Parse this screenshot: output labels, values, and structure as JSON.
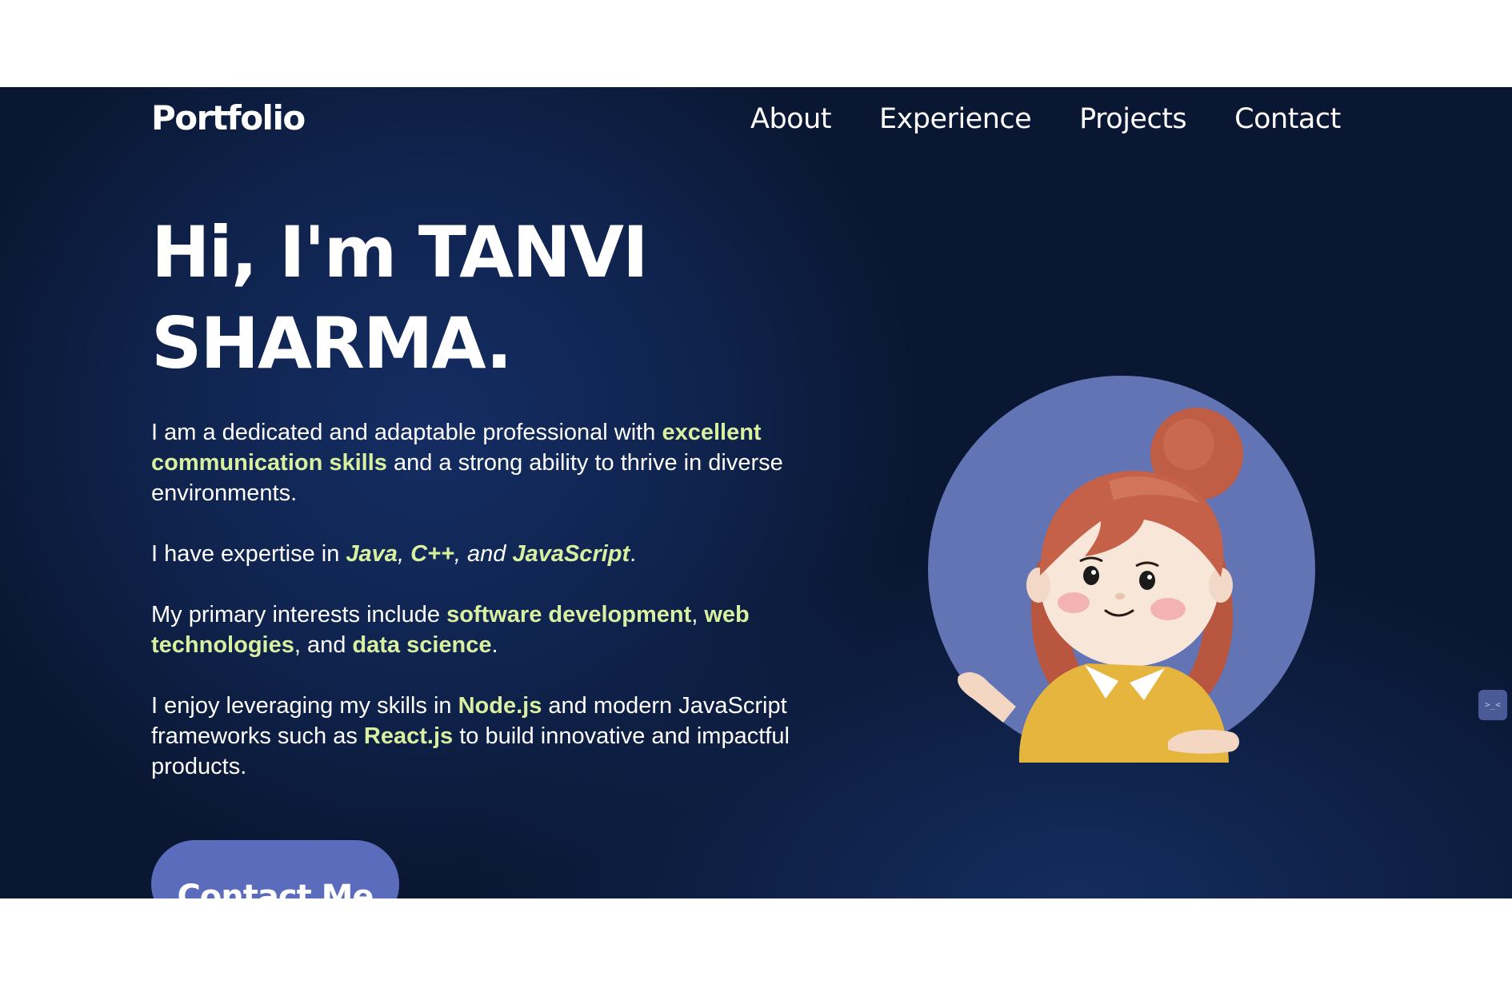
{
  "header": {
    "logo": "Portfolio",
    "nav": [
      "About",
      "Experience",
      "Projects",
      "Contact"
    ]
  },
  "hero": {
    "title_line1": "Hi, I'm TANVI",
    "title_line2": "SHARMA.",
    "p1": {
      "text_a": "I am a dedicated and adaptable professional with ",
      "hl": "excellent communication skills",
      "text_b": " and a strong ability to thrive in diverse environments."
    },
    "p2": {
      "text_a": "I have expertise in ",
      "lang1": "Java",
      "sep1": ", ",
      "lang2": "C++",
      "sep2": ", and ",
      "lang3": "JavaScript",
      "text_b": "."
    },
    "p3": {
      "text_a": "My primary interests include ",
      "hl1": "software development",
      "sep1": ", ",
      "hl2": "web technologies",
      "sep2": ", and ",
      "hl3": "data science",
      "text_b": "."
    },
    "p4": {
      "text_a": "I enjoy leveraging my skills in ",
      "hl1": "Node.js",
      "text_b": " and modern JavaScript frameworks such as ",
      "hl2": "React.js",
      "text_c": " to build innovative and impactful products."
    },
    "cta": "Contact Me"
  },
  "widget": {
    "glyph": ">_<"
  },
  "colors": {
    "background": "#0a1733",
    "highlight": "#d8f0a0",
    "button": "#5b6cbd",
    "avatar_circle": "#6374b4"
  },
  "icons": {
    "avatar": "cartoon-girl-avatar",
    "widget": "terminal-icon"
  }
}
